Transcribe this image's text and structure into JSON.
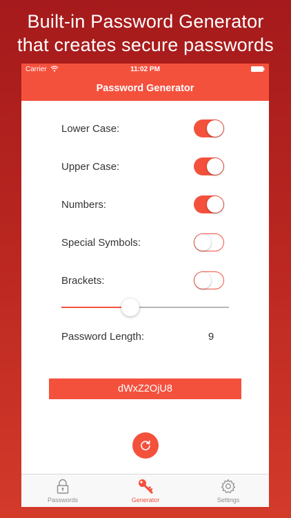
{
  "headline": {
    "line1": "Built-in Password Generator",
    "line2": "that creates secure passwords"
  },
  "status_bar": {
    "carrier": "Carrier",
    "time": "11:02 PM"
  },
  "nav": {
    "title": "Password Generator"
  },
  "options": [
    {
      "label": "Lower Case:",
      "enabled": true
    },
    {
      "label": "Upper Case:",
      "enabled": true
    },
    {
      "label": "Numbers:",
      "enabled": true
    },
    {
      "label": "Special Symbols:",
      "enabled": false
    },
    {
      "label": "Brackets:",
      "enabled": false
    }
  ],
  "length_slider": {
    "value_fraction": 0.41
  },
  "password_length": {
    "label": "Password Length:",
    "value": "9"
  },
  "generated_password": "dWxZ2OjU8",
  "tabs": [
    {
      "label": "Passwords",
      "icon": "lock-icon",
      "active": false
    },
    {
      "label": "Generator",
      "icon": "key-icon",
      "active": true
    },
    {
      "label": "Settings",
      "icon": "gear-icon",
      "active": false
    }
  ],
  "colors": {
    "accent": "#f4513d",
    "background_top": "#a51a1c",
    "background_bottom": "#d33a2a"
  }
}
